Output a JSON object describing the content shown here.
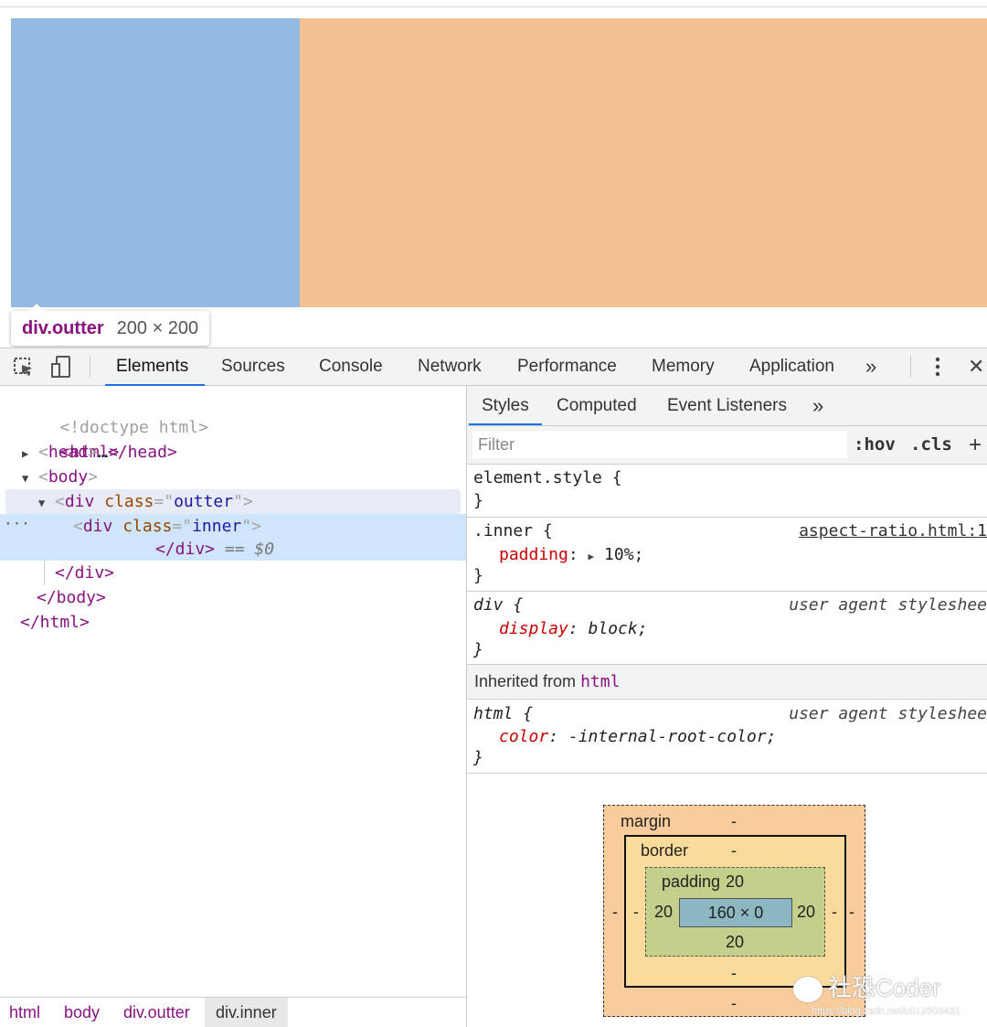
{
  "preview": {
    "tooltip": {
      "selector": "div.outter",
      "dimensions": "200 × 200"
    },
    "colors": {
      "inner": "#94b9e3",
      "outer": "#f4c290"
    }
  },
  "toolbar": {
    "icons": [
      "inspect-element-icon",
      "device-toggle-icon",
      "more-tabs-icon",
      "kebab-menu-icon",
      "close-icon"
    ],
    "tabs": [
      "Elements",
      "Sources",
      "Console",
      "Network",
      "Performance",
      "Memory",
      "Application"
    ],
    "active_tab": "Elements",
    "more": "»",
    "close": "✕"
  },
  "dom_tree": {
    "doctype": "<!doctype html>",
    "html_open": "<html>",
    "head": {
      "tag": "head",
      "ellipsis": "…",
      "close": "</head>"
    },
    "body_open": "body",
    "outer_div": {
      "tag": "div",
      "attr": "class",
      "value": "outter"
    },
    "inner_div": {
      "tag": "div",
      "attr": "class",
      "value": "inner",
      "close": "</div>",
      "console_ref": "== $0"
    },
    "close_div": "</div>",
    "close_body": "</body>",
    "close_html": "</html>",
    "gutter_dots": "···"
  },
  "breadcrumbs": [
    "html",
    "body",
    "div.outter",
    "div.inner"
  ],
  "styles_tabs": {
    "tabs": [
      "Styles",
      "Computed",
      "Event Listeners"
    ],
    "active": "Styles",
    "more": "»"
  },
  "filter": {
    "placeholder": "Filter",
    "hov": ":hov",
    "cls": ".cls",
    "add": "+"
  },
  "rules": {
    "element_style": {
      "selector": "element.style {",
      "close": "}"
    },
    "inner": {
      "selector": ".inner {",
      "prop": "padding",
      "value": "10%;",
      "source": "aspect-ratio.html:1",
      "close": "}"
    },
    "div": {
      "selector": "div {",
      "prop": "display",
      "value": "block;",
      "source": "user agent styleshee",
      "close": "}"
    },
    "inherited": {
      "label": "Inherited from",
      "tag": "html"
    },
    "html": {
      "selector": "html {",
      "prop": "color",
      "value": "-internal-root-color;",
      "source": "user agent styleshee",
      "close": "}"
    }
  },
  "box_model": {
    "margin_label": "margin",
    "margin_top": "-",
    "margin_left": "-",
    "margin_right": "-",
    "margin_bottom": "-",
    "border_label": "border",
    "border_top": "-",
    "border_left": "-",
    "border_right": "-",
    "border_bottom": "-",
    "padding_label": "padding",
    "padding_top": "20",
    "padding_left": "20",
    "padding_right": "20",
    "padding_bottom": "20",
    "content": "160 × 0",
    "colors": {
      "margin": "#f9cc9d",
      "border": "#fbdb9c",
      "padding": "#c3cf8a",
      "content": "#8cb6c0"
    }
  },
  "watermark": {
    "text": "社恐Coder",
    "url": "https://blog.csdn.net/u012503431"
  }
}
